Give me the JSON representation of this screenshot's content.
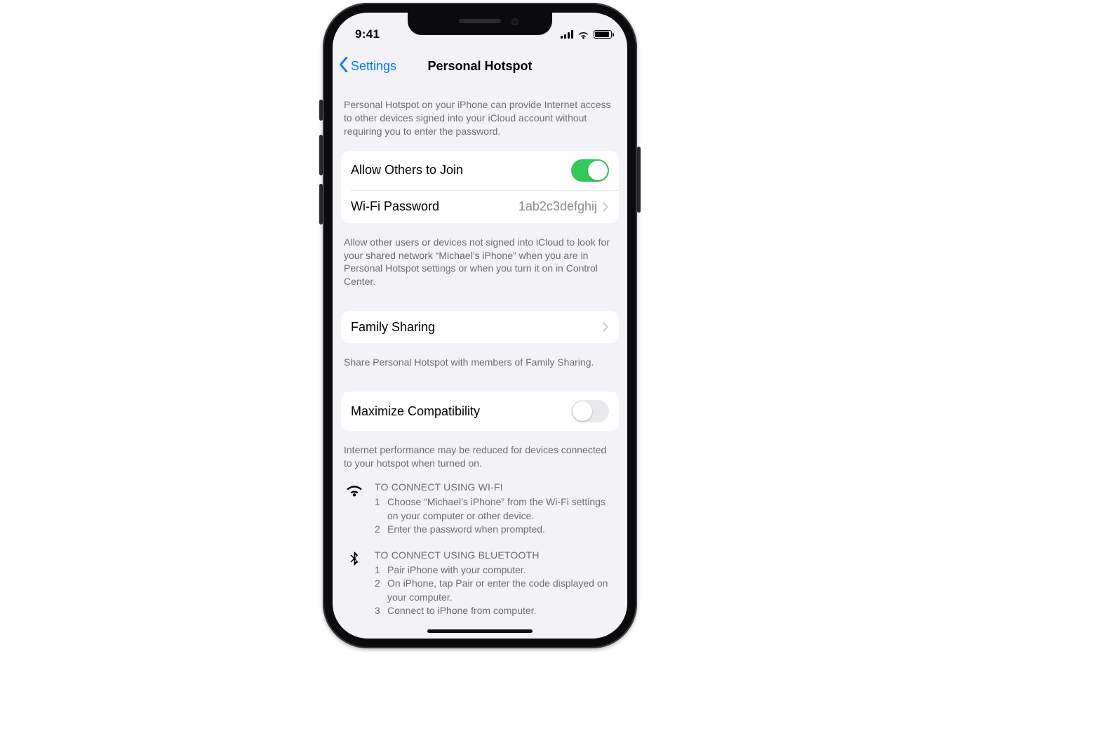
{
  "status": {
    "time": "9:41"
  },
  "nav": {
    "back_label": "Settings",
    "title": "Personal Hotspot"
  },
  "intro": "Personal Hotspot on your iPhone can provide Internet access to other devices signed into your iCloud account without requiring you to enter the password.",
  "settings": {
    "allow_others_label": "Allow Others to Join",
    "wifi_password_label": "Wi-Fi Password",
    "wifi_password_value": "1ab2c3defghij"
  },
  "allow_hint": "Allow other users or devices not signed into iCloud to look for your shared network “Michael’s iPhone” when you are in Personal Hotspot settings or when you turn it on in Control Center.",
  "family": {
    "label": "Family Sharing",
    "hint": "Share Personal Hotspot with members of Family Sharing."
  },
  "compat": {
    "label": "Maximize Compatibility",
    "hint": "Internet performance may be reduced for devices connected to your hotspot when turned on."
  },
  "wifi_instr": {
    "head": "TO CONNECT USING WI-FI",
    "steps": [
      "Choose “Michael’s iPhone” from the Wi-Fi settings on your computer or other device.",
      "Enter the password when prompted."
    ]
  },
  "bt_instr": {
    "head": "TO CONNECT USING BLUETOOTH",
    "steps": [
      "Pair iPhone with your computer.",
      "On iPhone, tap Pair or enter the code displayed on your computer.",
      "Connect to iPhone from computer."
    ]
  }
}
